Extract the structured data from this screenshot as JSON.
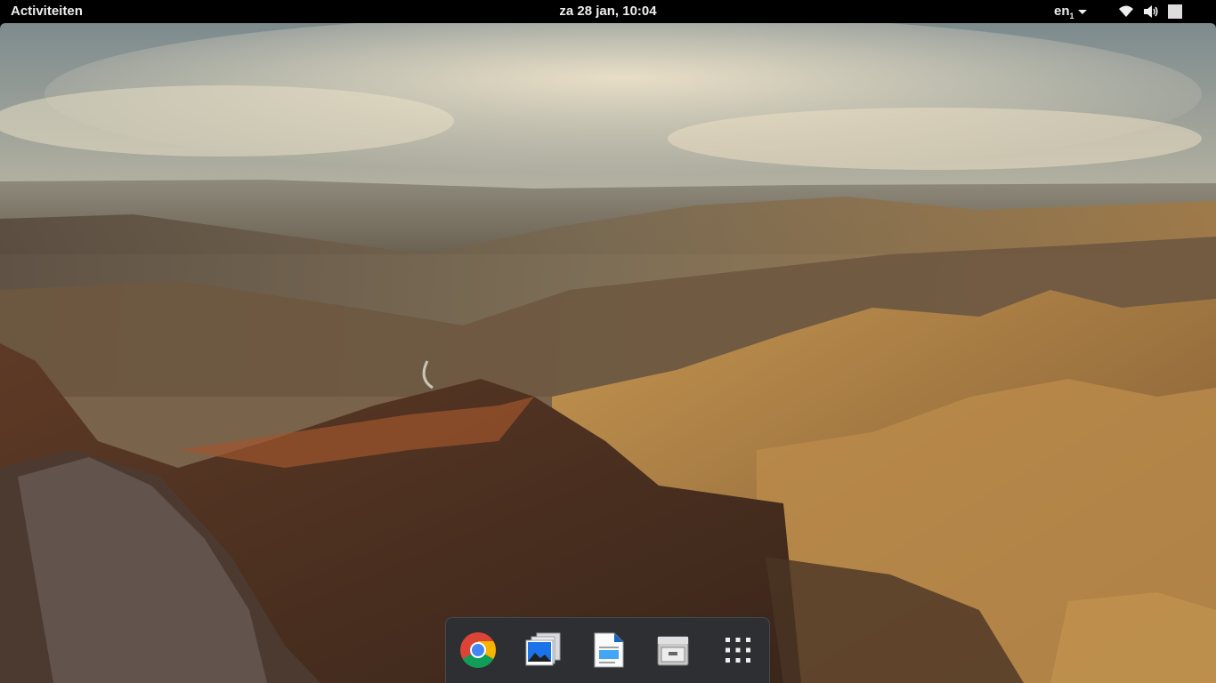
{
  "top_bar": {
    "activities_label": "Activiteiten",
    "clock": "za 28 jan, 10:04",
    "input_source": "en",
    "input_source_sub": "1",
    "status_icons": [
      "wifi-icon",
      "volume-icon",
      "battery-icon"
    ]
  },
  "dash": {
    "items": [
      {
        "icon": "chrome-icon",
        "name": "Google Chrome"
      },
      {
        "icon": "image-viewer-icon",
        "name": "Image Viewer"
      },
      {
        "icon": "document-viewer-icon",
        "name": "Document"
      },
      {
        "icon": "file-cabinet-icon",
        "name": "Files"
      },
      {
        "icon": "app-grid-icon",
        "name": "Show Applications"
      }
    ]
  },
  "colors": {
    "top_bar_bg": "#000000",
    "dash_bg": "#2d3034",
    "text": "#eeeeee"
  }
}
